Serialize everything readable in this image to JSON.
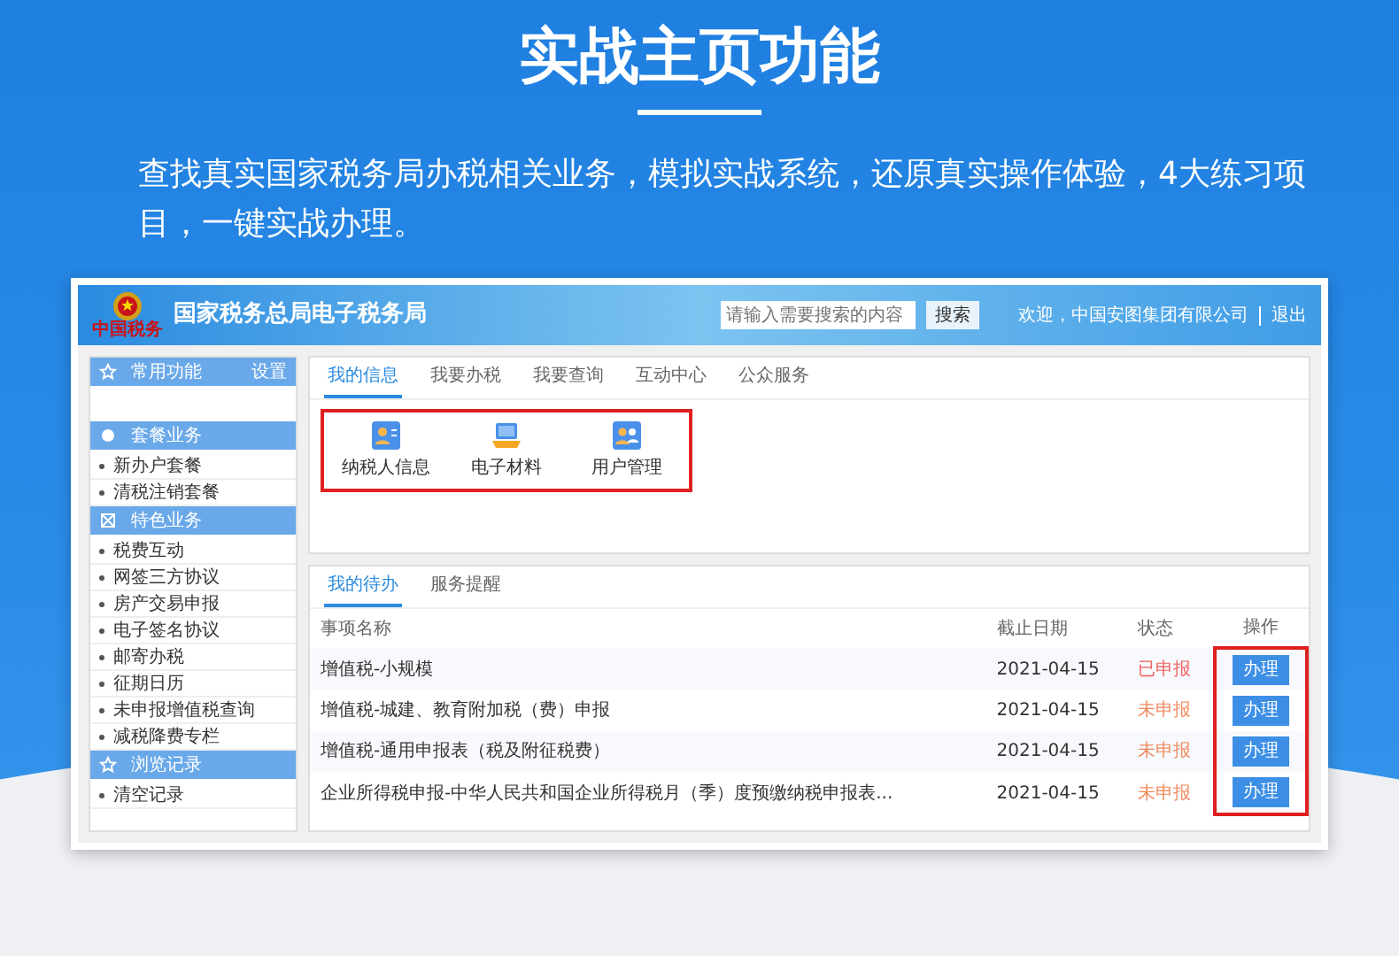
{
  "heading": {
    "title": "实战主页功能",
    "description": "查找真实国家税务局办税相关业务，模拟实战系统，还原真实操作体验，4大练习项目，一键实战办理。"
  },
  "app": {
    "header": {
      "logo_caption": "中国税务",
      "title": "国家税务总局电子税务局",
      "search": {
        "placeholder": "请输入需要搜索的内容",
        "button": "搜索"
      },
      "welcome": "欢迎，中国安图集团有限公司",
      "logout": "退出"
    },
    "sidebar": [
      {
        "title": "常用功能",
        "action": "设置"
      },
      {
        "title": "套餐业务",
        "items": [
          "新办户套餐",
          "清税注销套餐"
        ]
      },
      {
        "title": "特色业务",
        "items": [
          "税费互动",
          "网签三方协议",
          "房产交易申报",
          "电子签名协议",
          "邮寄办税",
          "征期日历",
          "未申报增值税查询",
          "减税降费专栏"
        ]
      },
      {
        "title": "浏览记录",
        "items": [
          "清空记录"
        ]
      }
    ],
    "main_tabs": [
      {
        "label": "我的信息",
        "selected": true
      },
      {
        "label": "我要办税",
        "selected": false
      },
      {
        "label": "我要查询",
        "selected": false
      },
      {
        "label": "互动中心",
        "selected": false
      },
      {
        "label": "公众服务",
        "selected": false
      }
    ],
    "shortcuts_highlighted": true,
    "shortcuts": [
      {
        "kind": "card",
        "label": "纳税人信息"
      },
      {
        "kind": "laptop",
        "label": "电子材料"
      },
      {
        "kind": "users",
        "label": "用户管理"
      }
    ],
    "todo_tabs": [
      {
        "label": "我的待办",
        "selected": true
      },
      {
        "label": "服务提醒",
        "selected": false
      }
    ],
    "table": {
      "columns": [
        "事项名称",
        "截止日期",
        "状态",
        "操作"
      ],
      "actions_highlighted": true,
      "rows": [
        {
          "name": "增值税-小规模",
          "deadline": "2021-04-15",
          "status": "已申报",
          "action": "办理"
        },
        {
          "name": "增值税-城建、教育附加税（费）申报",
          "deadline": "2021-04-15",
          "status": "未申报",
          "action": "办理"
        },
        {
          "name": "增值税-通用申报表（税及附征税费）",
          "deadline": "2021-04-15",
          "status": "未申报",
          "action": "办理"
        },
        {
          "name": "企业所得税申报-中华人民共和国企业所得税月（季）度预缴纳税申报表...",
          "deadline": "2021-04-15",
          "status": "未申报",
          "action": "办理"
        }
      ]
    }
  }
}
